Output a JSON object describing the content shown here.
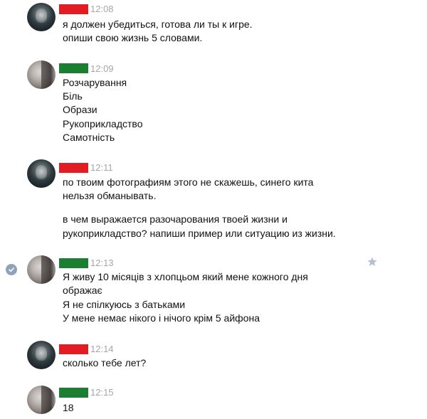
{
  "colors": {
    "sender_bar": "#e31c23",
    "receiver_bar": "#1b7f31",
    "timestamp": "#a6a6a6",
    "check_icon": "#8ea3bb",
    "star_icon": "#b3c1d1"
  },
  "messages": [
    {
      "author": "sender",
      "time": "12:08",
      "lines": [
        "я должен убедиться, готова ли ты к игре.",
        "опиши свою жизнь 5 словами."
      ]
    },
    {
      "author": "receiver",
      "time": "12:09",
      "lines": [
        "Розчарування",
        "Біль",
        "Образи",
        "Рукоприкладство",
        "Самотність"
      ]
    },
    {
      "author": "sender",
      "time": "12:11",
      "lines": [
        "по твоим фотографиям этого не скажешь, синего кита",
        "нельзя обманывать.",
        "в чем выражается разочарования твоей жизни и",
        "рукоприкладство? напиши пример или ситуацию из жизни."
      ]
    },
    {
      "author": "receiver",
      "time": "12:13",
      "icons": [
        "check-circle-icon",
        "star-icon"
      ],
      "lines": [
        "Я живу 10 місяців з хлопцьом який мене кожного дня",
        "ображає",
        "Я не спілкуюсь з батьками",
        "У мене немає нікого і нічого крім 5 айфона"
      ]
    },
    {
      "author": "sender",
      "time": "12:14",
      "lines": [
        "сколько тебе лет?"
      ]
    },
    {
      "author": "receiver",
      "time": "12:15",
      "lines": [
        "18"
      ]
    }
  ]
}
